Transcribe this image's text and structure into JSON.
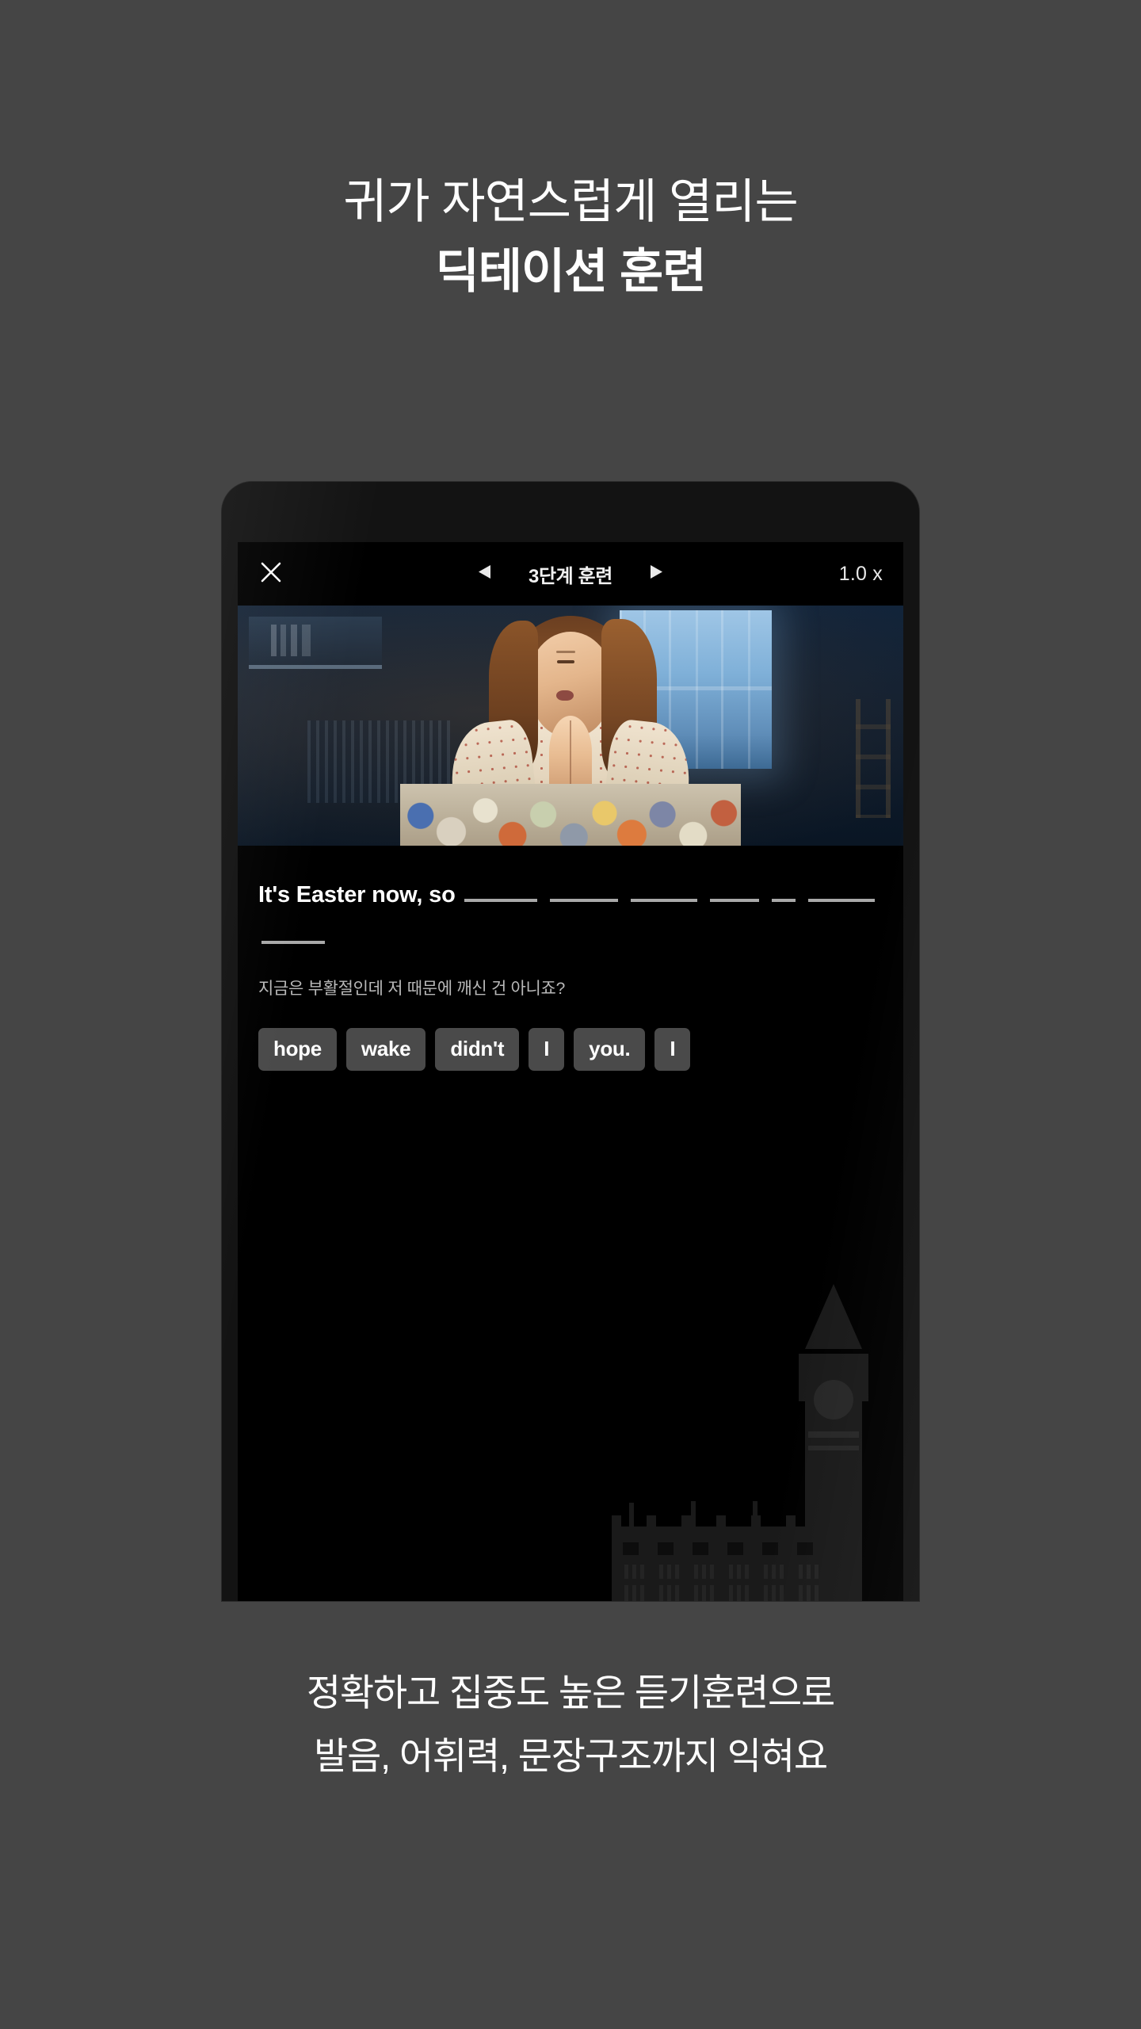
{
  "headline": {
    "line1": "귀가 자연스럽게 열리는",
    "line2": "딕테이션 훈련"
  },
  "phone": {
    "appbar": {
      "close_icon": "close-x-icon",
      "prev_icon": "triangle-left-icon",
      "next_icon": "triangle-right-icon",
      "title": "3단계 훈련",
      "speed": "1.0 x"
    },
    "video": {
      "alt": "girl praying on a bed with colorful quilt in a dark blue bedroom"
    },
    "dictation": {
      "sentence_prefix": "It's Easter now, so",
      "blanks_row1": [
        92,
        86,
        84,
        62
      ],
      "blanks_row2": [
        30,
        84,
        80
      ],
      "translation": "지금은 부활절인데 저 때문에 깨신 건 아니죠?",
      "word_chips": [
        "hope",
        "wake",
        "didn't",
        "I",
        "you.",
        "I"
      ]
    },
    "decoration": {
      "silhouette": "big-ben-westminster-silhouette"
    }
  },
  "caption": {
    "line1": "정확하고 집중도 높은 듣기훈련으로",
    "line2": "발음, 어휘력, 문장구조까지 익혀요"
  },
  "colors": {
    "page_background": "#454545",
    "phone_frame": "#131313",
    "screen_background": "#000000",
    "chip_background": "#4a4a4a",
    "text_primary": "#ffffff",
    "text_secondary": "#b9b9b9",
    "blank_line": "#a9a9a9"
  }
}
